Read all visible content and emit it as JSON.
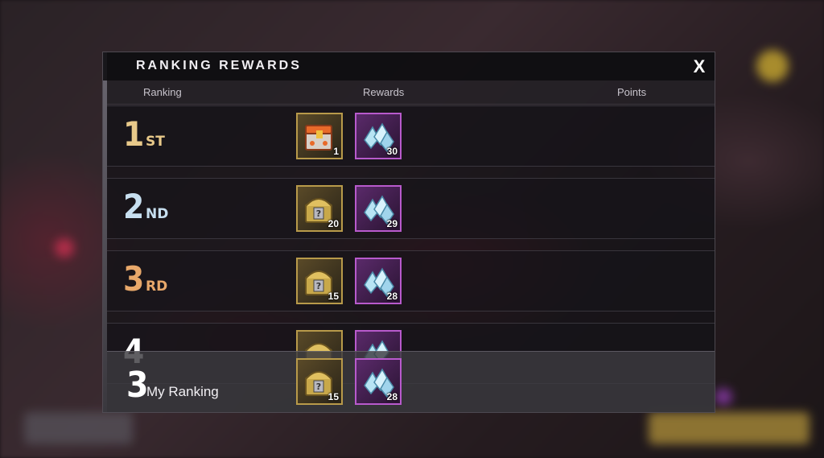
{
  "panel": {
    "title": "RANKING REWARDS",
    "close_label": "X"
  },
  "columns": {
    "ranking": "Ranking",
    "rewards": "Rewards",
    "points": "Points"
  },
  "rows": [
    {
      "rank": "1",
      "suffix": "ST",
      "tier": "gold",
      "rewards": [
        {
          "icon": "legendary-chest-icon",
          "count": "1"
        },
        {
          "icon": "crystal-cluster-icon",
          "count": "30"
        }
      ]
    },
    {
      "rank": "2",
      "suffix": "ND",
      "tier": "silver",
      "rewards": [
        {
          "icon": "mystery-chest-icon",
          "count": "20"
        },
        {
          "icon": "crystal-cluster-icon",
          "count": "29"
        }
      ]
    },
    {
      "rank": "3",
      "suffix": "RD",
      "tier": "bronze",
      "rewards": [
        {
          "icon": "mystery-chest-icon",
          "count": "15"
        },
        {
          "icon": "crystal-cluster-icon",
          "count": "28"
        }
      ]
    },
    {
      "rank": "4",
      "suffix": "",
      "tier": "white",
      "rewards": [
        {
          "icon": "mystery-chest-icon",
          "count": ""
        },
        {
          "icon": "crystal-cluster-icon",
          "count": ""
        }
      ]
    }
  ],
  "my_ranking": {
    "rank": "3",
    "label": "My Ranking",
    "rewards": [
      {
        "icon": "mystery-chest-icon",
        "count": "15"
      },
      {
        "icon": "crystal-cluster-icon",
        "count": "28"
      }
    ]
  },
  "colors": {
    "gold": "#e8c98a",
    "silver": "#c7dff0",
    "bronze": "#e8a86a",
    "purple_frame": "#b85acc",
    "gold_frame": "#b89a4a"
  }
}
